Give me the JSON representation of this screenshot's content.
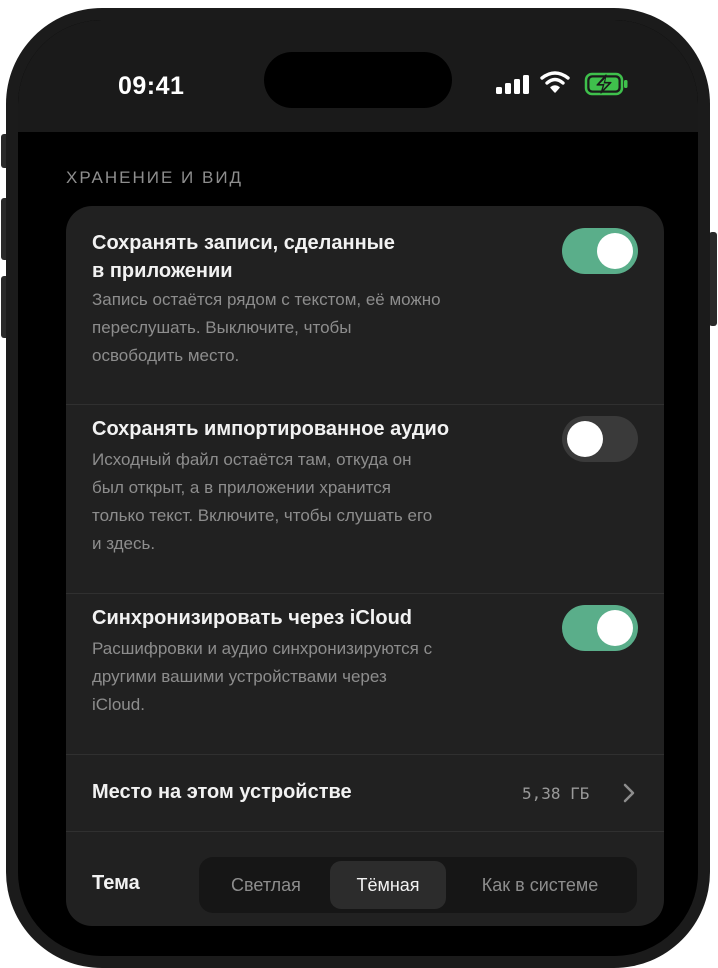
{
  "status_bar": {
    "time": "09:41"
  },
  "section": {
    "title": "ХРАНЕНИЕ И ВИД"
  },
  "settings": [
    {
      "title_line1": "Сохранять записи, сделанные",
      "title_line2": "в приложении",
      "desc_lines": [
        "Запись остаётся рядом с текстом, её можно",
        "переслушать. Выключите, чтобы",
        "освободить место."
      ],
      "enabled": true
    },
    {
      "title_line1": "Сохранять импортированное аудио",
      "desc_lines": [
        "Исходный файл остаётся там, откуда он",
        "был открыт, а в приложении хранится",
        "только текст. Включите, чтобы слушать его",
        "и здесь."
      ],
      "enabled": false
    },
    {
      "title_line1": "Синхронизировать через iCloud",
      "desc_lines": [
        "Расшифровки и аудио синхронизируются с",
        "другими вашими устройствами через",
        "iCloud."
      ],
      "enabled": true
    }
  ],
  "storage": {
    "label": "Место на этом устройстве",
    "value": "5,38 ГБ"
  },
  "theme": {
    "label": "Тема",
    "options": [
      "Светлая",
      "Тёмная",
      "Как в системе"
    ],
    "selected": "Тёмная"
  },
  "colors": {
    "accent": "#5aae8a",
    "card": "#212121",
    "background": "#000000"
  },
  "icons": [
    "signal-icon",
    "wifi-icon",
    "battery-charging-icon",
    "chevron-right-icon"
  ]
}
